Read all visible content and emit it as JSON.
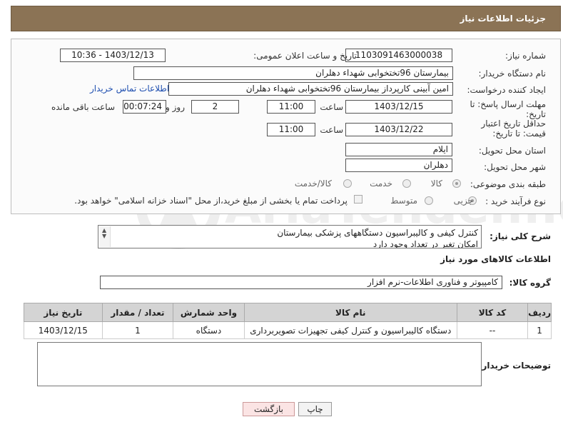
{
  "header": {
    "title": "جزئیات اطلاعات نیاز"
  },
  "form": {
    "need_number_label": "شماره نیاز:",
    "need_number": "1103091463000038",
    "announce_label": "تاریخ و ساعت اعلان عمومی:",
    "announce_value": "1403/12/13 - 10:36",
    "buyer_org_label": "نام دستگاه خریدار:",
    "buyer_org": "بیمارستان 96تختخوابی شهداء دهلران",
    "creator_label": "ایجاد کننده درخواست:",
    "creator": "امین آبینی کارپرداز بیمارستان 96تختخوابی شهداء دهلران",
    "contact_link": "اطلاعات تماس خریدار",
    "deadline_label": "مهلت ارسال پاسخ: تا تاریخ:",
    "deadline_date": "1403/12/15",
    "time_label": "ساعت",
    "deadline_time": "11:00",
    "days_value": "2",
    "days_label": "روز و",
    "remaining_value": "00:07:24",
    "remaining_label": "ساعت باقی مانده",
    "validity_label": "حداقل تاریخ اعتبار قیمت: تا تاریخ:",
    "validity_date": "1403/12/22",
    "validity_time": "11:00",
    "province_label": "استان محل تحویل:",
    "province": "ایلام",
    "city_label": "شهر محل تحویل:",
    "city": "دهلران",
    "category_label": "طبقه بندی موضوعی:",
    "cat_goods": "کالا",
    "cat_service": "خدمت",
    "cat_both": "کالا/خدمت",
    "process_label": "نوع فرآیند خرید :",
    "proc_partial": "جزیی",
    "proc_medium": "متوسط",
    "payment_note": "پرداخت تمام یا بخشی از مبلغ خرید،از محل \"اسناد خزانه اسلامی\" خواهد بود."
  },
  "description": {
    "label": "شرح کلی نیاز:",
    "line1": "کنترل کیفی و کالیبراسیون دستگاههای پزشکی بیمارستان",
    "line2": "امکان تغیر در تعداد وجود دارد"
  },
  "goods": {
    "section_title": "اطلاعات کالاهای مورد نیاز",
    "group_label": "گروه کالا:",
    "group_value": "کامپیوتر و فناوری اطلاعات-نرم افزار",
    "columns": [
      "ردیف",
      "کد کالا",
      "نام کالا",
      "واحد شمارش",
      "تعداد / مقدار",
      "تاریخ نیاز"
    ],
    "rows": [
      {
        "idx": "1",
        "code": "--",
        "name": "دستگاه کالیبراسیون و کنترل کیفی تجهیزات تصویربرداری",
        "unit": "دستگاه",
        "qty": "1",
        "date": "1403/12/15"
      }
    ]
  },
  "buyer_notes": {
    "label": "توضیحات خریدار:"
  },
  "buttons": {
    "print": "چاپ",
    "back": "بازگشت"
  },
  "watermark": {
    "text": "AriaTender.net"
  },
  "colors": {
    "header": "#8b7355",
    "link": "#1f4fb0",
    "back_button": "#fbe4e4"
  }
}
